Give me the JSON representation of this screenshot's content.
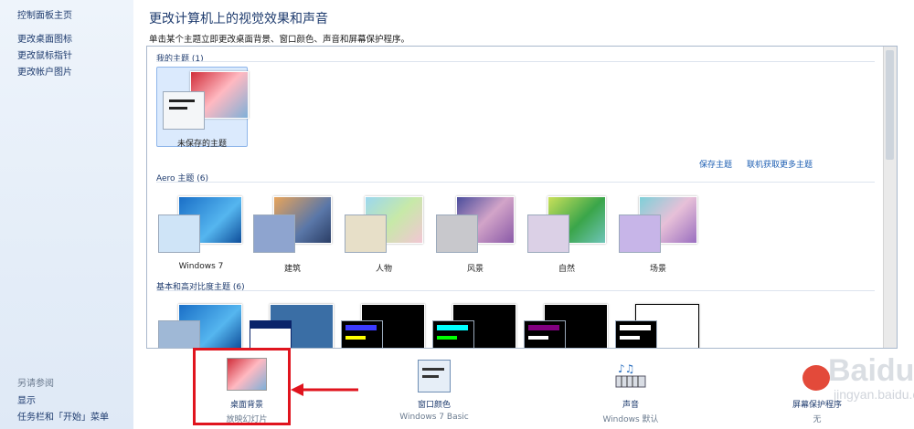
{
  "sidebar": {
    "home_link": "控制面板主页",
    "links": [
      "更改桌面图标",
      "更改鼠标指针",
      "更改帐户图片"
    ],
    "see_also_title": "另请参阅",
    "see_also_links": [
      "显示",
      "任务栏和「开始」菜单"
    ]
  },
  "main": {
    "title": "更改计算机上的视觉效果和声音",
    "description": "单击某个主题立即更改桌面背景、窗口颜色、声音和屏幕保护程序。"
  },
  "sections": {
    "my_themes": {
      "header": "我的主题 (1)",
      "theme_label": "未保存的主题"
    },
    "save_theme_link": "保存主题",
    "get_more_link": "联机获取更多主题",
    "aero": {
      "header": "Aero 主题 (6)",
      "themes": [
        "Windows 7",
        "建筑",
        "人物",
        "风景",
        "自然",
        "场景"
      ]
    },
    "basic": {
      "header": "基本和高对比度主题 (6)"
    }
  },
  "bottom": {
    "desktop_bg": {
      "title": "桌面背景",
      "sub": "放映幻灯片"
    },
    "window_color": {
      "title": "窗口颜色",
      "sub": "Windows 7 Basic"
    },
    "sounds": {
      "title": "声音",
      "sub": "Windows 默认"
    },
    "screensaver": {
      "title": "屏幕保护程序",
      "sub": "无"
    }
  },
  "watermark": {
    "brand": "Baidu 经验",
    "url": "jingyan.baidu.com"
  },
  "colors": {
    "highlight": "#e0141e",
    "link": "#1e5fb3",
    "title": "#1e3b6e"
  }
}
